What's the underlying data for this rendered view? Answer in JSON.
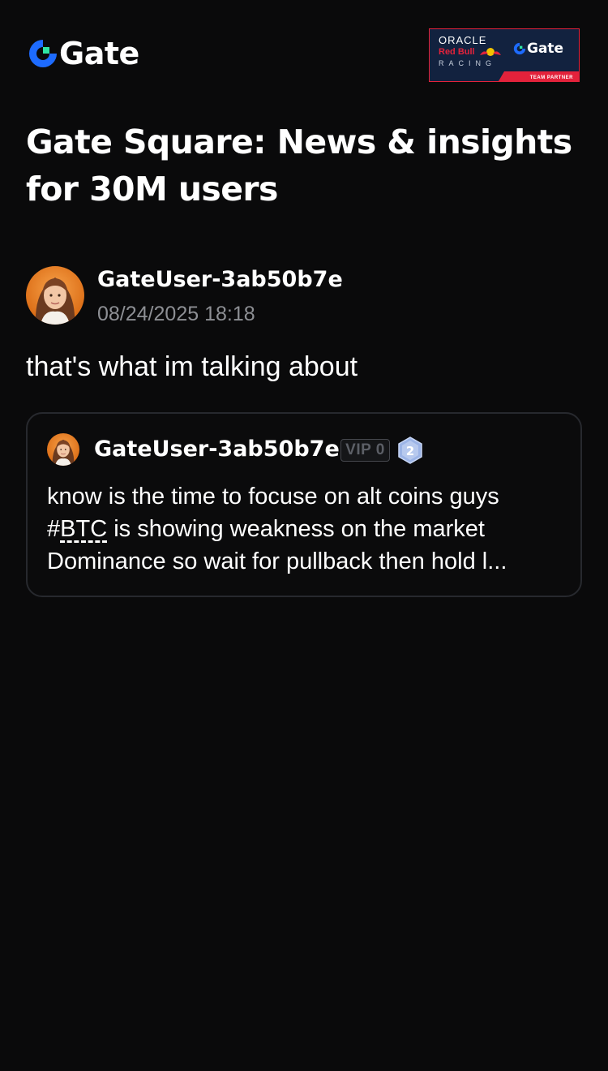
{
  "header": {
    "logo_text": "Gate",
    "logo_icon": "gate-logo-icon",
    "partner_banner": {
      "oracle": "ORACLE",
      "redbull": "Red Bull",
      "racing": "RACING",
      "gate": "Gate",
      "strip": "TEAM PARTNER"
    }
  },
  "page": {
    "title": "Gate Square: News & insights for 30M users"
  },
  "post": {
    "author": "GateUser-3ab50b7e",
    "timestamp": "08/24/2025 18:18",
    "text": "that's what im talking about"
  },
  "quote": {
    "author": "GateUser-3ab50b7e",
    "vip_label": "VIP 0",
    "level": "2",
    "line1": "know is the time to focuse on alt coins guys",
    "hash_symbol": "#",
    "hashtag": "BTC",
    "line2_rest": " is showing weakness on the market",
    "line3": "Dominance so wait for pullback then hold l..."
  },
  "colors": {
    "background": "#0a0a0b",
    "brand_blue": "#1d6bff",
    "brand_green": "#2fe6a4",
    "muted_text": "#8d8f94",
    "card_border": "#27292e"
  }
}
